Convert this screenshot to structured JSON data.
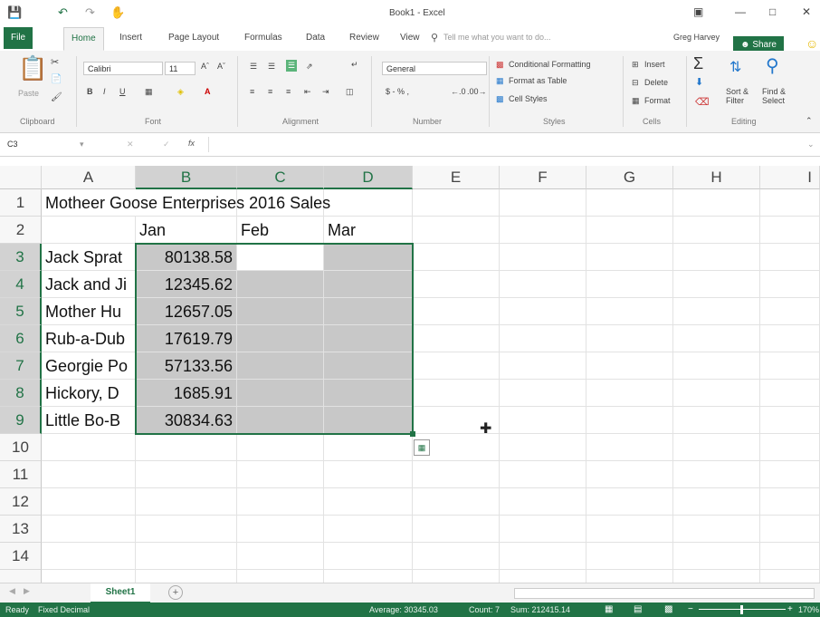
{
  "title_bar": {
    "doc_title": "Book1 - Excel",
    "user": "Greg Harvey"
  },
  "tabs": [
    "File",
    "Home",
    "Insert",
    "Page Layout",
    "Formulas",
    "Data",
    "Review",
    "View"
  ],
  "tell_me": "Tell me what you want to do...",
  "share_label": "Share",
  "ribbon": {
    "paste": "Paste",
    "font_name": "Calibri",
    "font_size": "11",
    "number_format": "General",
    "currency": "$ - % ,",
    "conditional_formatting": "Conditional Formatting",
    "format_as_table": "Format as Table",
    "cell_styles": "Cell Styles",
    "insert": "Insert",
    "delete": "Delete",
    "format": "Format",
    "sort_filter": "Sort & Filter",
    "find_select": "Find & Select",
    "groups": [
      "Clipboard",
      "Font",
      "Alignment",
      "Number",
      "Styles",
      "Cells",
      "Editing"
    ]
  },
  "formula_bar": {
    "name_box": "C3",
    "fx": "fx",
    "content": ""
  },
  "columns": [
    "A",
    "B",
    "C",
    "D",
    "E",
    "F",
    "G",
    "H",
    "I"
  ],
  "rows": [
    "1",
    "2",
    "3",
    "4",
    "5",
    "6",
    "7",
    "8",
    "9",
    "10",
    "11",
    "12",
    "13",
    "14"
  ],
  "sheet": {
    "title": "Motheer Goose Enterprises 2016 Sales",
    "months": [
      "Jan",
      "Feb",
      "Mar"
    ],
    "names": [
      "Jack Sprat",
      "Jack and Ji",
      "Mother Hu",
      "Rub-a-Dub",
      "Georgie Po",
      "Hickory, D",
      "Little Bo-B"
    ],
    "jan": [
      "80138.58",
      "12345.62",
      "12657.05",
      "17619.79",
      "57133.56",
      "1685.91",
      "30834.63"
    ]
  },
  "sheet_tabs": [
    "Sheet1"
  ],
  "add_sheet": "+",
  "status": {
    "mode": "Ready",
    "fixed_decimal": "Fixed Decimal",
    "average": "Average: 30345.03",
    "count": "Count: 7",
    "sum": "Sum: 212415.14",
    "zoom": "170%"
  },
  "colors": {
    "accent": "#217346",
    "selection": "#c8c8c8"
  }
}
